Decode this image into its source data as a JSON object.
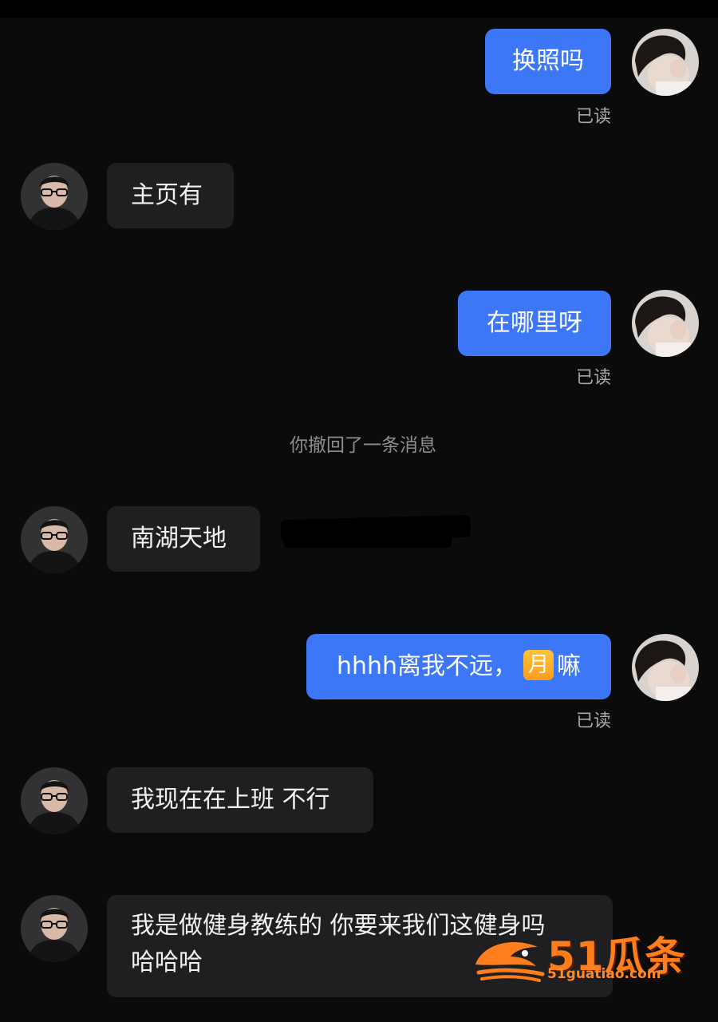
{
  "conversation": {
    "messages": [
      {
        "side": "out",
        "text": "换照吗",
        "read_label": "已读"
      },
      {
        "side": "in",
        "text": "主页有"
      },
      {
        "side": "out",
        "text": "在哪里呀",
        "read_label": "已读"
      },
      {
        "side": "system",
        "text": "你撤回了一条消息"
      },
      {
        "side": "in",
        "text": "南湖天地"
      },
      {
        "side": "out",
        "text_before": "hhhh离我不远，",
        "emoji": "月",
        "text_after": "嘛",
        "read_label": "已读"
      },
      {
        "side": "in",
        "text": "我现在在上班 不行"
      },
      {
        "side": "in",
        "lines": [
          "我是做健身教练的 你要来我们这健身吗",
          "哈哈哈"
        ]
      }
    ]
  },
  "watermark": {
    "brand": "51瓜条",
    "url": "51guatiao.com"
  },
  "colors": {
    "background": "#0b0b0c",
    "outgoing_bubble": "#3b77f6",
    "incoming_bubble": "#1f1f21",
    "read_text": "#a9a9ad",
    "watermark": "#ff7d1a"
  }
}
